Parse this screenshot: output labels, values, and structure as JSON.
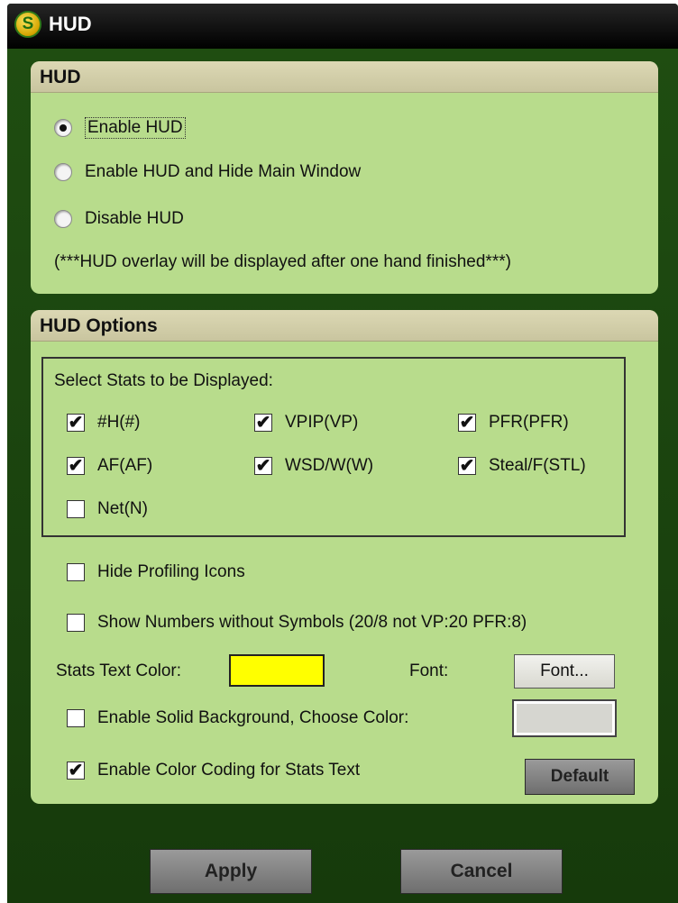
{
  "window": {
    "title": "HUD",
    "icon": "dollar-logo-icon",
    "icon_glyph": "S"
  },
  "hud_group": {
    "title": "HUD",
    "options": [
      {
        "label": "Enable HUD",
        "selected": true
      },
      {
        "label": "Enable HUD and Hide Main Window",
        "selected": false
      },
      {
        "label": "Disable HUD",
        "selected": false
      }
    ],
    "note": "(***HUD overlay will be displayed after one hand finished***)"
  },
  "options_group": {
    "title": "HUD Options",
    "stats_caption": "Select Stats to be Displayed:",
    "stats": [
      {
        "label": "#H(#)",
        "checked": true
      },
      {
        "label": "VPIP(VP)",
        "checked": true
      },
      {
        "label": "PFR(PFR)",
        "checked": true
      },
      {
        "label": "AF(AF)",
        "checked": true
      },
      {
        "label": "WSD/W(W)",
        "checked": true
      },
      {
        "label": "Steal/F(STL)",
        "checked": true
      },
      {
        "label": "Net(N)",
        "checked": false
      }
    ],
    "hide_profiling": {
      "label": "Hide Profiling Icons",
      "checked": false
    },
    "show_numbers": {
      "label": "Show Numbers without Symbols (20/8 not VP:20 PFR:8)",
      "checked": false
    },
    "stats_text_color_label": "Stats Text Color:",
    "stats_text_color": "#ffff00",
    "font_label": "Font:",
    "font_button": "Font...",
    "solid_background": {
      "label": "Enable Solid Background, Choose Color:",
      "checked": false
    },
    "background_color": "#d6d6d0",
    "color_coding": {
      "label": "Enable Color Coding for Stats Text",
      "checked": true
    },
    "default_button": "Default"
  },
  "footer": {
    "apply": "Apply",
    "cancel": "Cancel"
  },
  "check_glyph": "✔"
}
